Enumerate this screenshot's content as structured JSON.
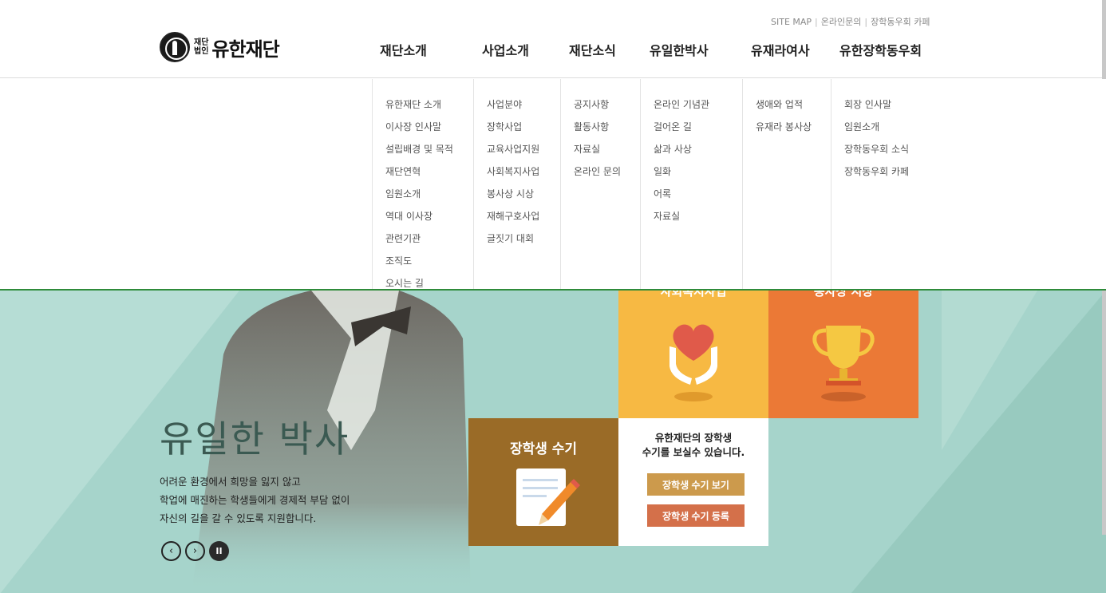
{
  "util_links": [
    "SITE MAP",
    "온라인문의",
    "장학동우회 카페"
  ],
  "logo": {
    "small_top": "재단",
    "small_bottom": "법인",
    "name": "유한재단"
  },
  "gnb": [
    "재단소개",
    "사업소개",
    "재단소식",
    "유일한박사",
    "유재라여사",
    "유한장학동우회"
  ],
  "menu": [
    [
      "유한재단 소개",
      "이사장 인사말",
      "설립배경 및 목적",
      "재단연혁",
      "임원소개",
      "역대 이사장",
      "관련기관",
      "조직도",
      "오시는 길"
    ],
    [
      "사업분야",
      "장학사업",
      "교육사업지원",
      "사회복지사업",
      "봉사상 시상",
      "재해구호사업",
      "글짓기 대회"
    ],
    [
      "공지사항",
      "활동사항",
      "자료실",
      "온라인 문의"
    ],
    [
      "온라인 기념관",
      "걸어온 길",
      "삶과 사상",
      "일화",
      "어록",
      "자료실"
    ],
    [
      "생애와 업적",
      "유재라 봉사상"
    ],
    [
      "회장 인사말",
      "임원소개",
      "장학동우회 소식",
      "장학동우회 카페"
    ]
  ],
  "hero": {
    "title": "유일한 박사",
    "desc": [
      "어려운 환경에서 희망을 잃지 않고",
      "학업에 매진하는 학생들에게 경제적 부담 없이",
      "자신의 길을 갈 수 있도록 지원합니다."
    ],
    "tile_yellow_label": "사회복지사업",
    "tile_orange_label": "봉사상 시상",
    "scholar_title": "장학생 수기",
    "scholar_text": [
      "유한재단의 장학생",
      "수기를 보실수 있습니다."
    ],
    "btn_view": "장학생 수기 보기",
    "btn_register": "장학생 수기 등록",
    "ctrl_prev": "‹",
    "ctrl_next": "›",
    "ctrl_pause": "II"
  },
  "colors": {
    "accent_green": "#2e8b3a",
    "hero_bg": "#a6d4cb",
    "tile_yellow": "#f7b943",
    "tile_orange": "#eb7936",
    "tile_brown": "#9a6b27"
  }
}
